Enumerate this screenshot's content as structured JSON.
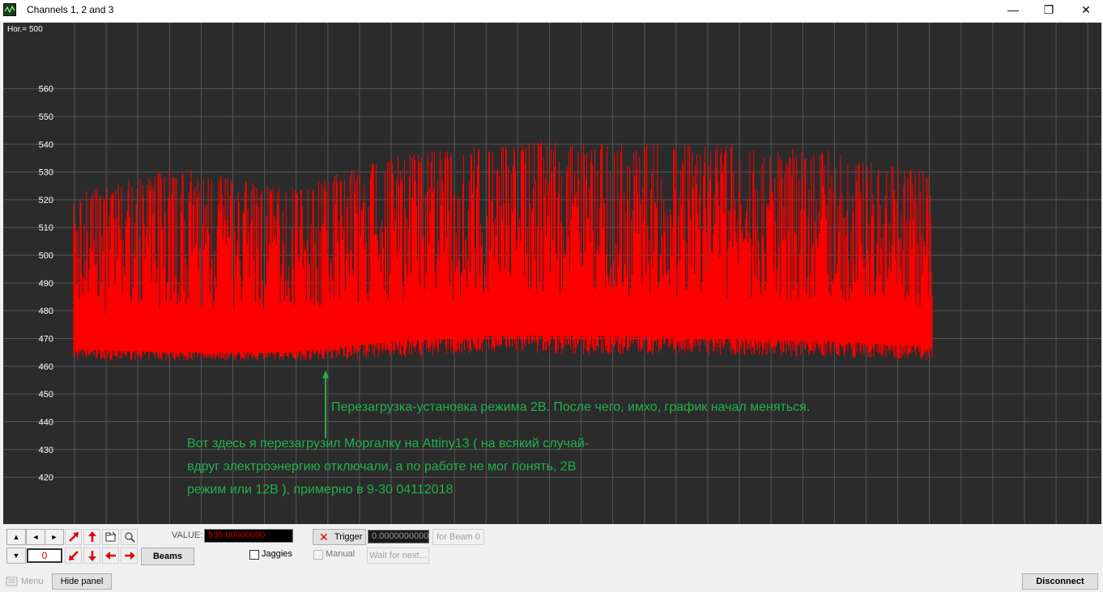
{
  "window": {
    "title": "Channels 1, 2 and 3",
    "controls": {
      "minimize": "—",
      "maximize": "❐",
      "close": "✕"
    }
  },
  "plot": {
    "hor_label": "Hor.= 500",
    "colors": {
      "background": "#2b2b2b",
      "grid": "#565656",
      "signal": "#ff0000",
      "annotation": "#22b14c"
    }
  },
  "chart_data": {
    "type": "line",
    "title": "",
    "xlabel": "",
    "ylabel": "",
    "ylim": [
      414,
      573
    ],
    "yticks": [
      560,
      550,
      540,
      530,
      520,
      510,
      500,
      490,
      480,
      470,
      460,
      450,
      440,
      430,
      420
    ],
    "grid": true,
    "series": [
      {
        "color": "#ff0000",
        "envelope_min_by_segment": [
          462,
          462,
          462,
          463,
          465,
          464,
          464,
          463,
          462
        ],
        "envelope_max_by_segment": [
          522,
          532,
          524,
          536,
          541,
          541,
          540,
          538,
          530
        ],
        "baseline_by_segment": [
          467,
          466,
          466,
          470,
          472,
          472,
          471,
          470,
          468
        ]
      }
    ],
    "annotations": [
      {
        "text": "Перезагрузка-установка режима 2В.  После чего, имхо, график начал меняться.",
        "arrow_to_value": 458
      },
      {
        "lines": [
          "Вот здесь я перезагрузил Моргалку на Attiny13 ( на всякий случай-",
          "вдруг электроэнергию отключали, а по работе не мог понять, 2В",
          "режим или 12В ), примерно в 9-30 04112018"
        ]
      }
    ]
  },
  "panel": {
    "value_label": "VALUE:",
    "value": "535.00000000",
    "beam_number": "0",
    "beams_button": "Beams",
    "jaggies_label": "Jaggies",
    "trigger_label": "Trigger",
    "trigger_value": "0.0000000000",
    "for_beam_button": "for Beam 0",
    "manual_label": "Manual",
    "wait_button": "Wait for next..."
  },
  "status": {
    "menu": "Menu",
    "hide_panel": "Hide panel",
    "disconnect": "Disconnect"
  }
}
